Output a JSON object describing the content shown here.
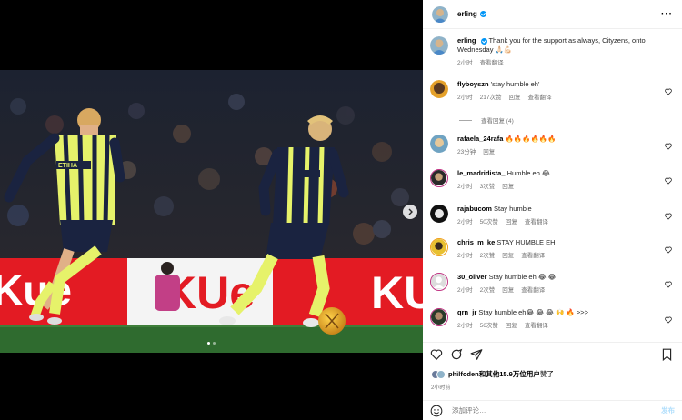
{
  "post": {
    "author": "erling",
    "caption_author": "erling",
    "caption": "Thank you for the support as always, Cityzens, onto Wednesday 🙏🏻💪🏻",
    "caption_time": "2小时",
    "caption_translate": "查看翻译",
    "likes_text": "和其他15.9万位用户",
    "likes_user": "philfoden",
    "likes_suffix": "赞了",
    "time": "2小时前",
    "add_comment_placeholder": "添加评论…",
    "post_label": "发布"
  },
  "comments": [
    {
      "user": "flyboyszn",
      "text": "'stay humble eh'",
      "time": "2小时",
      "likes": "217次赞",
      "reply": "回复",
      "translate": "查看翻译",
      "view_replies": "查看回复 (4)"
    },
    {
      "user": "rafaela_24rafa",
      "text": "🔥🔥🔥🔥🔥🔥",
      "time": "23分钟",
      "likes": "",
      "reply": "回复",
      "translate": ""
    },
    {
      "user": "le_madridista_",
      "text": "Humble eh 😂",
      "time": "2小时",
      "likes": "3次赞",
      "reply": "回复",
      "translate": ""
    },
    {
      "user": "rajabucom",
      "text": "Stay humble",
      "time": "2小时",
      "likes": "50次赞",
      "reply": "回复",
      "translate": "查看翻译"
    },
    {
      "user": "chris_m_ke",
      "text": "STAY HUMBLE EH",
      "time": "2小时",
      "likes": "2次赞",
      "reply": "回复",
      "translate": "查看翻译"
    },
    {
      "user": "30_oliver",
      "text": "Stay humble eh 😂 😂",
      "time": "2小时",
      "likes": "2次赞",
      "reply": "回复",
      "translate": "查看翻译"
    },
    {
      "user": "qrn_jr",
      "text": "Stay humble eh😂 😂 😂 🙌 🔥 >>>",
      "time": "2小时",
      "likes": "56次赞",
      "reply": "回复",
      "translate": "查看翻译"
    }
  ],
  "photo": {
    "board_text_left": "Kue",
    "board_text_mid": "KUe",
    "board_text_right": "KU",
    "shirt_text": "ETIHA"
  },
  "colors": {
    "kit": "#e6f26a",
    "navy": "#1a2340",
    "board": "#e31b23",
    "pitch": "#2f6b2f",
    "verified": "#0095f6"
  }
}
